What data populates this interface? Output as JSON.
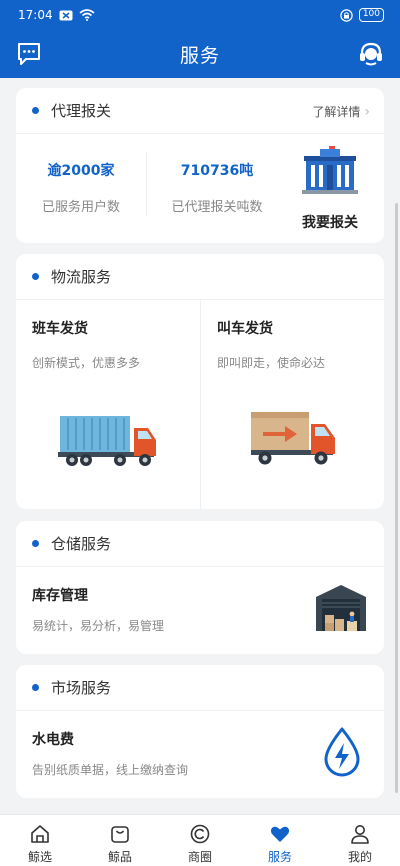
{
  "status_bar": {
    "time": "17:04",
    "battery": "100"
  },
  "nav": {
    "title": "服务",
    "left_icon": "message-icon",
    "right_icon": "customer-service-icon"
  },
  "customs": {
    "section_title": "代理报关",
    "more_label": "了解详情",
    "stat_users_value": "逾2000家",
    "stat_users_label": "已服务用户数",
    "stat_tons_value": "710736吨",
    "stat_tons_label": "已代理报关吨数",
    "action_label": "我要报关"
  },
  "logistics": {
    "section_title": "物流服务",
    "left": {
      "title": "班车发货",
      "subtitle": "创新模式，优惠多多"
    },
    "right": {
      "title": "叫车发货",
      "subtitle": "即叫即走，使命必达"
    }
  },
  "warehouse": {
    "section_title": "仓储服务",
    "title": "库存管理",
    "subtitle": "易统计，易分析，易管理"
  },
  "market": {
    "section_title": "市场服务",
    "title": "水电费",
    "subtitle": "告别纸质单据，线上缴纳查询"
  },
  "tabs": [
    {
      "label": "鲸选",
      "icon": "home-icon"
    },
    {
      "label": "鲸品",
      "icon": "bag-icon"
    },
    {
      "label": "商圈",
      "icon": "circle-icon"
    },
    {
      "label": "服务",
      "icon": "heart-icon"
    },
    {
      "label": "我的",
      "icon": "user-icon"
    }
  ],
  "colors": {
    "primary": "#1163c9",
    "background": "#f2f3f5"
  }
}
